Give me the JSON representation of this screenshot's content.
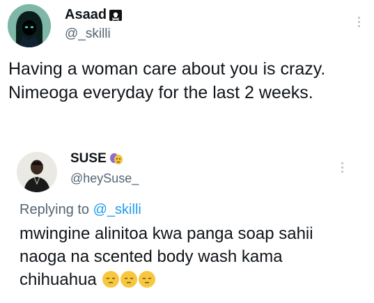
{
  "original_tweet": {
    "display_name": "Asaad",
    "handle": "@_skilli",
    "lines": [
      "Having a woman care about you is crazy.",
      "Nimeoga everyday for the last 2 weeks."
    ],
    "badge_icon": "pirate-flag-icon"
  },
  "reply_tweet": {
    "display_name": "SUSE",
    "handle": "@heySuse_",
    "badge_icon": "performing-arts-icon",
    "replying_prefix": "Replying to",
    "replying_handle": "@_skilli",
    "lines": [
      "mwingine alinitoa kwa panga soap sahii",
      "naoga na scented body wash kama",
      "chihuahua"
    ],
    "emojis": [
      "pensive-face-emoji",
      "pensive-face-emoji",
      "pensive-face-emoji"
    ]
  },
  "colors": {
    "text": "#0f1419",
    "secondary": "#536471",
    "link": "#1d9bf0"
  }
}
